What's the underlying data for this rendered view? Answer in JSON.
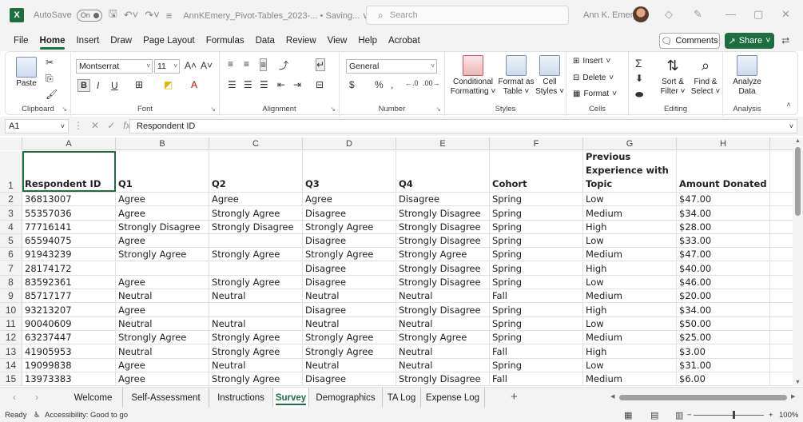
{
  "titlebar": {
    "app_logo": "X",
    "autosave_label": "AutoSave",
    "autosave_state": "On",
    "doc_title": "AnnKEmery_Pivot-Tables_2023-...  •  Saving... ∨",
    "search_placeholder": "Search",
    "user_name": "Ann K. Emery"
  },
  "ribbon_tabs": [
    "File",
    "Home",
    "Insert",
    "Draw",
    "Page Layout",
    "Formulas",
    "Data",
    "Review",
    "View",
    "Help",
    "Acrobat"
  ],
  "active_tab": "Home",
  "buttons": {
    "comments": "Comments",
    "share": "Share"
  },
  "ribbon": {
    "clipboard": {
      "label": "Clipboard",
      "paste": "Paste"
    },
    "font": {
      "label": "Font",
      "family": "Montserrat",
      "size": "11"
    },
    "alignment": {
      "label": "Alignment"
    },
    "number": {
      "label": "Number",
      "format": "General"
    },
    "styles": {
      "label": "Styles",
      "conditional": "Conditional Formatting ˅",
      "format_table": "Format as Table ˅",
      "cell_styles": "Cell Styles ˅"
    },
    "cells": {
      "label": "Cells",
      "insert": "Insert",
      "delete": "Delete",
      "format": "Format"
    },
    "editing": {
      "label": "Editing",
      "sort": "Sort & Filter ˅",
      "find": "Find & Select ˅"
    },
    "analysis": {
      "label": "Analysis",
      "analyze": "Analyze Data"
    }
  },
  "formula_bar": {
    "name_box": "A1",
    "content": "Respondent ID"
  },
  "columns": [
    "A",
    "B",
    "C",
    "D",
    "E",
    "F",
    "G",
    "H"
  ],
  "header_row": {
    "row_num": "1",
    "cells": [
      "Respondent ID",
      "Q1",
      "Q2",
      "Q3",
      "Q4",
      "Cohort",
      "Previous Experience with Topic",
      "Amount Donated"
    ]
  },
  "rows": [
    {
      "num": "2",
      "cells": [
        "36813007",
        "Agree",
        "Agree",
        "Agree",
        "Disagree",
        "Spring",
        "Low",
        "$47.00"
      ]
    },
    {
      "num": "3",
      "cells": [
        "55357036",
        "Agree",
        "Strongly Agree",
        "Disagree",
        "Strongly Disagree",
        "Spring",
        "Medium",
        "$34.00"
      ]
    },
    {
      "num": "4",
      "cells": [
        "77716141",
        "Strongly Disagree",
        "Strongly Disagree",
        "Strongly Agree",
        "Strongly Disagree",
        "Spring",
        "High",
        "$28.00"
      ]
    },
    {
      "num": "5",
      "cells": [
        "65594075",
        "Agree",
        "",
        "Disagree",
        "Strongly Disagree",
        "Spring",
        "Low",
        "$33.00"
      ]
    },
    {
      "num": "6",
      "cells": [
        "91943239",
        "Strongly Agree",
        "Strongly Agree",
        "Strongly Agree",
        "Strongly Agree",
        "Spring",
        "Medium",
        "$47.00"
      ]
    },
    {
      "num": "7",
      "cells": [
        "28174172",
        "",
        "",
        "Disagree",
        "Strongly Disagree",
        "Spring",
        "High",
        "$40.00"
      ]
    },
    {
      "num": "8",
      "cells": [
        "83592361",
        "Agree",
        "Strongly Agree",
        "Disagree",
        "Strongly Disagree",
        "Spring",
        "Low",
        "$46.00"
      ]
    },
    {
      "num": "9",
      "cells": [
        "85717177",
        "Neutral",
        "Neutral",
        "Neutral",
        "Neutral",
        "Fall",
        "Medium",
        "$20.00"
      ]
    },
    {
      "num": "10",
      "cells": [
        "93213207",
        "Agree",
        "",
        "Disagree",
        "Strongly Disagree",
        "Spring",
        "High",
        "$34.00"
      ]
    },
    {
      "num": "11",
      "cells": [
        "90040609",
        "Neutral",
        "Neutral",
        "Neutral",
        "Neutral",
        "Spring",
        "Low",
        "$50.00"
      ]
    },
    {
      "num": "12",
      "cells": [
        "63237447",
        "Strongly Agree",
        "Strongly Agree",
        "Strongly Agree",
        "Strongly Agree",
        "Spring",
        "Medium",
        "$25.00"
      ]
    },
    {
      "num": "13",
      "cells": [
        "41905953",
        "Neutral",
        "Strongly Agree",
        "Strongly Agree",
        "Neutral",
        "Fall",
        "High",
        "$3.00"
      ]
    },
    {
      "num": "14",
      "cells": [
        "19099838",
        "Agree",
        "Neutral",
        "Neutral",
        "Neutral",
        "Spring",
        "Low",
        "$31.00"
      ]
    },
    {
      "num": "15",
      "cells": [
        "13973383",
        "Agree",
        "Strongly Agree",
        "Disagree",
        "Strongly Disagree",
        "Fall",
        "Medium",
        "$6.00"
      ]
    }
  ],
  "sheets": [
    "Welcome",
    "Self-Assessment",
    "Instructions",
    "Survey",
    "Demographics",
    "TA Log",
    "Expense Log"
  ],
  "active_sheet": "Survey",
  "status": {
    "ready": "Ready",
    "accessibility": "Accessibility: Good to go",
    "zoom": "100%"
  },
  "colors": {
    "excel_green": "#1d6f42",
    "chrome_gray": "#f3f3f3"
  }
}
